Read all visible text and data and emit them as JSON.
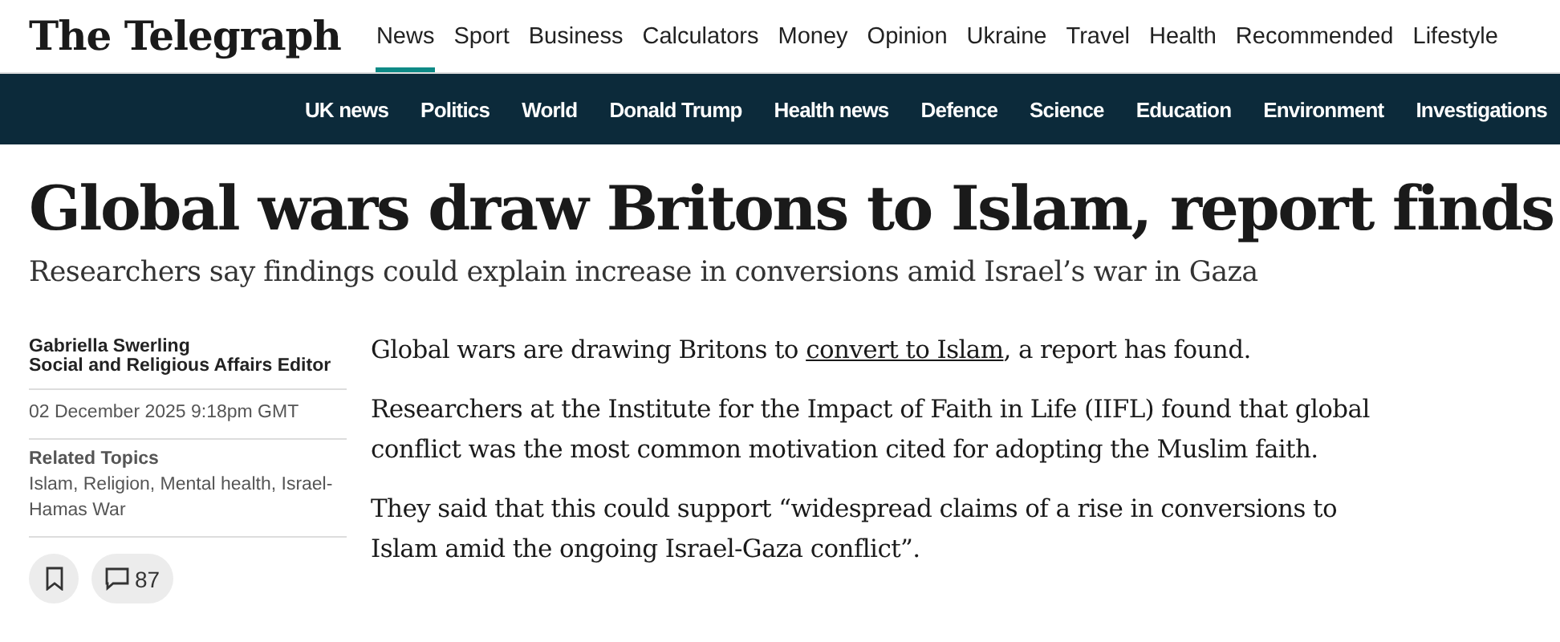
{
  "masthead": {
    "logo": "The Telegraph"
  },
  "primary_nav": [
    {
      "label": "News",
      "selected": true
    },
    {
      "label": "Sport",
      "selected": false
    },
    {
      "label": "Business",
      "selected": false
    },
    {
      "label": "Calculators",
      "selected": false
    },
    {
      "label": "Money",
      "selected": false
    },
    {
      "label": "Opinion",
      "selected": false
    },
    {
      "label": "Ukraine",
      "selected": false
    },
    {
      "label": "Travel",
      "selected": false
    },
    {
      "label": "Health",
      "selected": false
    },
    {
      "label": "Recommended",
      "selected": false
    },
    {
      "label": "Lifestyle",
      "selected": false
    }
  ],
  "secondary_nav": [
    "UK news",
    "Politics",
    "World",
    "Donald Trump",
    "Health news",
    "Defence",
    "Science",
    "Education",
    "Environment",
    "Investigations"
  ],
  "headline": "Global wars draw Britons to Islam, report finds",
  "standfirst": "Researchers say findings could explain increase in conversions amid Israel’s war in Gaza",
  "byline": {
    "author": "Gabriella Swerling",
    "role": "Social and Religious Affairs Editor",
    "date": "02 December 2025 9:18pm GMT"
  },
  "related_topics": {
    "label": "Related Topics",
    "topics": "Islam, Religion, Mental health, Israel-Hamas War"
  },
  "actions": {
    "comments": "87"
  },
  "body": [
    {
      "before": "Global wars are drawing Britons to ",
      "link": "convert to Islam",
      "after": ", a report has found."
    },
    {
      "before": "Researchers at the Institute for the Impact of Faith in Life (IIFL) found that global conflict was the most common motivation cited for adopting the Muslim faith."
    },
    {
      "before": "They said that this could support “widespread claims of a rise in conversions to Islam amid the ongoing Israel-Gaza conflict”."
    }
  ]
}
